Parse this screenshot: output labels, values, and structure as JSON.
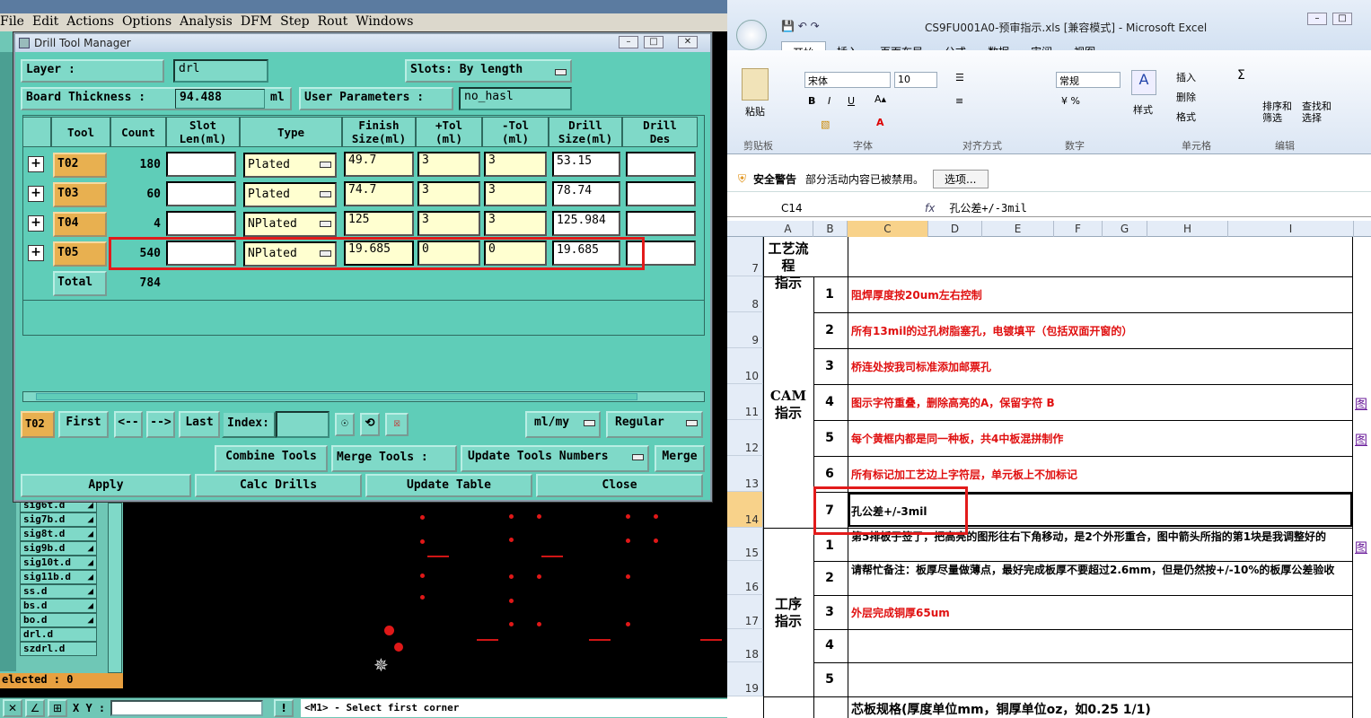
{
  "genesis": {
    "menu": [
      "File",
      "Edit",
      "Actions",
      "Options",
      "Analysis",
      "DFM",
      "Step",
      "Rout",
      "Windows"
    ],
    "layers": [
      {
        "name": "sig6t.d"
      },
      {
        "name": "sig7b.d"
      },
      {
        "name": "sig8t.d"
      },
      {
        "name": "sig9b.d"
      },
      {
        "name": "sig10t.d"
      },
      {
        "name": "sig11b.d"
      },
      {
        "name": "ss.d"
      },
      {
        "name": "bs.d"
      },
      {
        "name": "bo.d"
      },
      {
        "name": "drl.d"
      },
      {
        "name": "szdrl.d"
      }
    ],
    "status": "elected : 0",
    "xy_label": "X Y :",
    "message": "<M1> - Select first corner"
  },
  "dtm": {
    "title": "Drill Tool Manager",
    "layer_label": "Layer        :",
    "layer_value": "drl",
    "slots_label": "Slots:",
    "slots_value": "By length",
    "thickness_label": "Board Thickness :",
    "thickness_value": "94.488",
    "thickness_unit": "ml",
    "user_params_label": "User Parameters :",
    "user_params_value": "no_hasl",
    "headers": [
      "Tool",
      "Count",
      "Slot\nLen(ml)",
      "Type",
      "Finish\nSize(ml)",
      "+Tol\n(ml)",
      "-Tol\n(ml)",
      "Drill\nSize(ml)",
      "Drill\nDes"
    ],
    "rows": [
      {
        "tool": "T02",
        "count": "180",
        "type": "Plated",
        "finish": "49.7",
        "ptol": "3",
        "ntol": "3",
        "drill": "53.15"
      },
      {
        "tool": "T03",
        "count": "60",
        "type": "Plated",
        "finish": "74.7",
        "ptol": "3",
        "ntol": "3",
        "drill": "78.74"
      },
      {
        "tool": "T04",
        "count": "4",
        "type": "NPlated",
        "finish": "125",
        "ptol": "3",
        "ntol": "3",
        "drill": "125.984"
      },
      {
        "tool": "T05",
        "count": "540",
        "type": "NPlated",
        "finish": "19.685",
        "ptol": "0",
        "ntol": "0",
        "drill": "19.685"
      }
    ],
    "total_label": "Total",
    "total_value": "784",
    "nav": {
      "current": "T02",
      "first": "First",
      "prev": "<--",
      "next": "-->",
      "last": "Last",
      "index_label": "Index:",
      "units": "ml/my",
      "mode": "Regular"
    },
    "combine": "Combine Tools",
    "merge_label": "Merge Tools :",
    "update_numbers": "Update Tools Numbers",
    "merge": "Merge",
    "apply": "Apply",
    "calc": "Calc Drills",
    "update_table": "Update Table",
    "close": "Close"
  },
  "excel": {
    "caption": "CS9FU001A0-预审指示.xls [兼容模式] - Microsoft Excel",
    "tabs": [
      "开始",
      "插入",
      "页面布局",
      "公式",
      "数据",
      "审阅",
      "视图"
    ],
    "ribbon": {
      "paste": "粘贴",
      "clipboard": "剪贴板",
      "font_name": "宋体",
      "font_size": "10",
      "font": "字体",
      "align": "对齐方式",
      "number_format": "常规",
      "number": "数字",
      "style": "样式",
      "insert": "插入",
      "delete": "删除",
      "format": "格式",
      "cells": "单元格",
      "sort": "排序和\n筛选",
      "find": "查找和\n选择",
      "edit": "编辑"
    },
    "security_title": "安全警告",
    "security_text": "部分活动内容已被禁用。",
    "options": "选项...",
    "cell_ref": "C14",
    "fx": "fx",
    "formula": "孔公差+/-3mil",
    "columns": [
      "A",
      "B",
      "C",
      "D",
      "E",
      "F",
      "G",
      "H",
      "I"
    ],
    "row_numbers": [
      "7",
      "8",
      "9",
      "10",
      "11",
      "12",
      "13",
      "14",
      "15",
      "16",
      "17",
      "18",
      "19"
    ],
    "sec_flow": "工艺流程\n指示",
    "sec_cam": "CAM\n指示",
    "sec_proc": "工序\n指示",
    "cam_items": [
      {
        "n": "1",
        "text": "阻焊厚度按20um左右控制"
      },
      {
        "n": "2",
        "text": "所有13mil的过孔树脂塞孔，电镀填平（包括双面开窗的）"
      },
      {
        "n": "3",
        "text": "桥连处按我司标准添加邮票孔"
      },
      {
        "n": "4",
        "text": "图示字符重叠，删除高亮的A，保留字符 B"
      },
      {
        "n": "5",
        "text": "每个黄框内都是同一种板，共4中板混拼制作"
      },
      {
        "n": "6",
        "text": "所有标记加工艺边上字符层，单元板上不加标记"
      },
      {
        "n": "7",
        "text": "孔公差+/-3mil"
      }
    ],
    "proc_items": [
      {
        "n": "1",
        "text": "第5排板子签了，把高亮的图形往右下角移动，是2个外形重合，图中箭头所指的第1块是我调整好的"
      },
      {
        "n": "2",
        "text": "请帮忙备注：板厚尽量做薄点，最好完成板厚不要超过2.6mm，但是仍然按+/-10%的板厚公差验收"
      },
      {
        "n": "3",
        "text": "外层完成铜厚65um"
      },
      {
        "n": "4",
        "text": ""
      },
      {
        "n": "5",
        "text": ""
      }
    ],
    "link_label": "图",
    "last_row": "芯板规格(厚度单位mm，铜厚单位oz，如0.25 1/1)"
  }
}
